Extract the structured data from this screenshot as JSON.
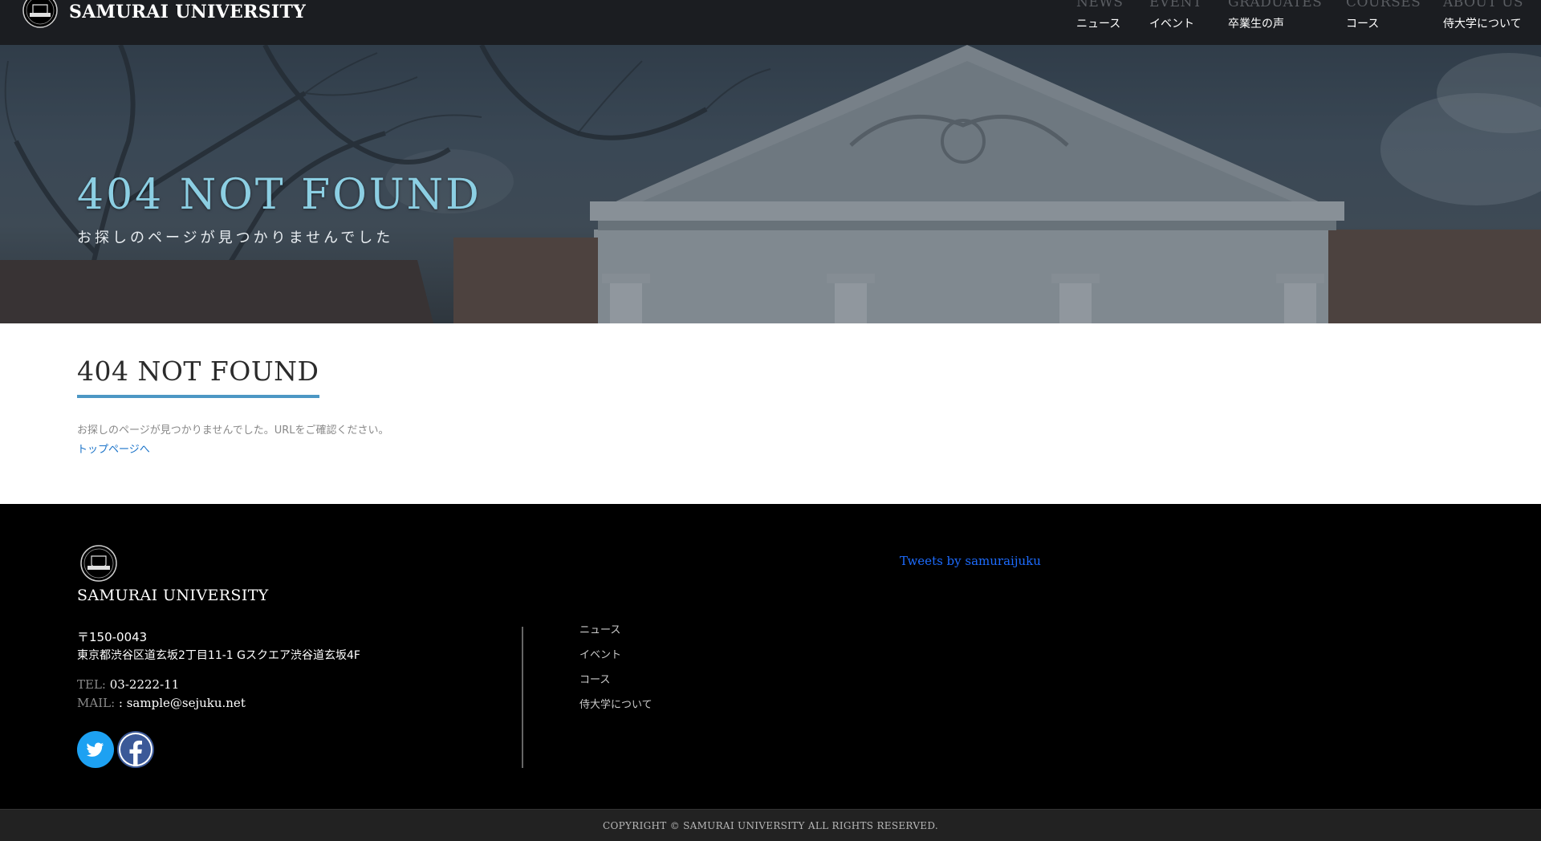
{
  "header": {
    "brand": "SAMURAI UNIVERSITY",
    "nav": [
      {
        "en": "NEWS",
        "ja": "ニュース"
      },
      {
        "en": "EVENT",
        "ja": "イベント"
      },
      {
        "en": "GRADUATES",
        "ja": "卒業生の声"
      },
      {
        "en": "COURSES",
        "ja": "コース"
      },
      {
        "en": "ABOUT US",
        "ja": "侍大学について"
      }
    ]
  },
  "hero": {
    "title": "404 NOT FOUND",
    "subtitle": "お探しのページが見つかりませんでした"
  },
  "main": {
    "title": "404 NOT FOUND",
    "message": "お探しのページが見つかりませんでした。URLをご確認ください。",
    "top_link": "トップページへ"
  },
  "footer": {
    "brand": "SAMURAI UNIVERSITY",
    "zip": "〒150-0043",
    "address": "東京都渋谷区道玄坂2丁目11-1 Gスクエア渋谷道玄坂4F",
    "tel_label": "TEL:",
    "tel": " 03-2222-11",
    "mail_label": "MAIL:",
    "mail": " : sample@sejuku.net",
    "nav": [
      "ニュース",
      "イベント",
      "コース",
      "侍大学について"
    ],
    "tweets": "Tweets by samuraijuku",
    "social": [
      "twitter-icon",
      "facebook-icon"
    ]
  },
  "copyright": "COPYRIGHT © SAMURAI UNIVERSITY ALL RIGHTS RESERVED.",
  "colors": {
    "accent": "#4c97c4",
    "link": "#1a73c9",
    "hero_title": "#8ccfe3",
    "twitter": "#1da1f2",
    "facebook": "#3b5998"
  }
}
